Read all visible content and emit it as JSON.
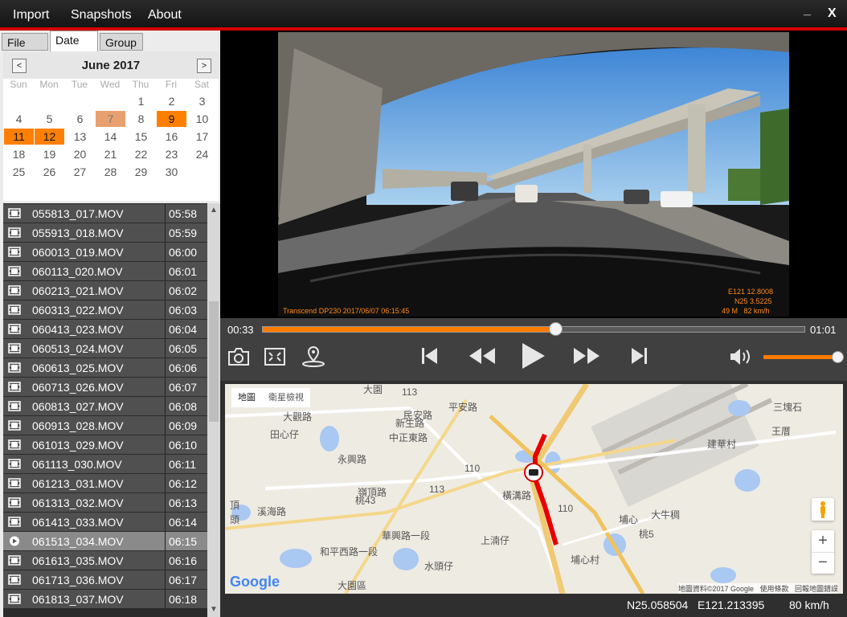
{
  "menu": {
    "import": "Import",
    "snapshots": "Snapshots",
    "about": "About",
    "minimize": "_",
    "close": "X"
  },
  "tabs": {
    "file": "File",
    "date": "Date",
    "group": "Group"
  },
  "calendar": {
    "title": "June 2017",
    "prev": "<",
    "next": ">",
    "weekdays": [
      "Sun",
      "Mon",
      "Tue",
      "Wed",
      "Thu",
      "Fri",
      "Sat"
    ],
    "days": [
      "1",
      "2",
      "3",
      "4",
      "5",
      "6",
      "7",
      "8",
      "9",
      "10",
      "11",
      "12",
      "13",
      "14",
      "15",
      "16",
      "17",
      "18",
      "19",
      "20",
      "21",
      "22",
      "23",
      "24",
      "25",
      "26",
      "27",
      "28",
      "29",
      "30"
    ],
    "recorded_days": [
      9,
      11,
      12
    ],
    "selected_day": 7
  },
  "files": [
    {
      "name": "055813_017.MOV",
      "time": "05:58"
    },
    {
      "name": "055913_018.MOV",
      "time": "05:59"
    },
    {
      "name": "060013_019.MOV",
      "time": "06:00"
    },
    {
      "name": "060113_020.MOV",
      "time": "06:01"
    },
    {
      "name": "060213_021.MOV",
      "time": "06:02"
    },
    {
      "name": "060313_022.MOV",
      "time": "06:03"
    },
    {
      "name": "060413_023.MOV",
      "time": "06:04"
    },
    {
      "name": "060513_024.MOV",
      "time": "06:05"
    },
    {
      "name": "060613_025.MOV",
      "time": "06:06"
    },
    {
      "name": "060713_026.MOV",
      "time": "06:07"
    },
    {
      "name": "060813_027.MOV",
      "time": "06:08"
    },
    {
      "name": "060913_028.MOV",
      "time": "06:09"
    },
    {
      "name": "061013_029.MOV",
      "time": "06:10"
    },
    {
      "name": "061113_030.MOV",
      "time": "06:11"
    },
    {
      "name": "061213_031.MOV",
      "time": "06:12"
    },
    {
      "name": "061313_032.MOV",
      "time": "06:13"
    },
    {
      "name": "061413_033.MOV",
      "time": "06:14"
    },
    {
      "name": "061513_034.MOV",
      "time": "06:15"
    },
    {
      "name": "061613_035.MOV",
      "time": "06:16"
    },
    {
      "name": "061713_036.MOV",
      "time": "06:17"
    },
    {
      "name": "061813_037.MOV",
      "time": "06:18"
    }
  ],
  "selected_file_index": 17,
  "video": {
    "overlay_left": "Transcend DP230 2017/06/07 06:15:45",
    "overlay_lon": "E121 12.8008",
    "overlay_lat": "N25 3.5225",
    "overlay_speed": "49 M   82 km/h"
  },
  "player": {
    "current_time": "00:33",
    "total_time": "01:01",
    "progress": 0.54,
    "volume": 1.0
  },
  "icons": {
    "snapshot": "camera-icon",
    "fullscreen": "fullscreen-icon",
    "location": "map-pin-icon",
    "prev": "skip-previous-icon",
    "rewind": "rewind-icon",
    "play": "play-icon",
    "forward": "fast-forward-icon",
    "next": "skip-next-icon",
    "volume": "volume-icon"
  },
  "map": {
    "tab_map": "地圖",
    "tab_satellite": "衛星檢視",
    "labels": [
      "大園",
      "113",
      "大觀路",
      "民安路",
      "平安路",
      "三塊石",
      "田心仔",
      "新生路",
      "中正東路",
      "建華村",
      "王厝",
      "永興路",
      "110",
      "113",
      "嶺頂路",
      "橫溝路",
      "110",
      "埔心",
      "大牛稠",
      "埔心村",
      "桃43",
      "桃5",
      "上湳仔",
      "水頭仔",
      "大園區",
      "和平西路一段",
      "華興路一段",
      "頂",
      "頭",
      "溪海路"
    ],
    "attribution": "地圖資料©2017 Google   使用條款   回報地圖錯誤",
    "google": "Google",
    "zoom_in": "+",
    "zoom_out": "−"
  },
  "status": {
    "coords": "N25.058504   E121.213395",
    "speed": "80 km/h"
  },
  "colors": {
    "accent": "#ff7a00",
    "brand_red": "#d40000",
    "route": "#e60000",
    "record_day": "#ff8000"
  }
}
